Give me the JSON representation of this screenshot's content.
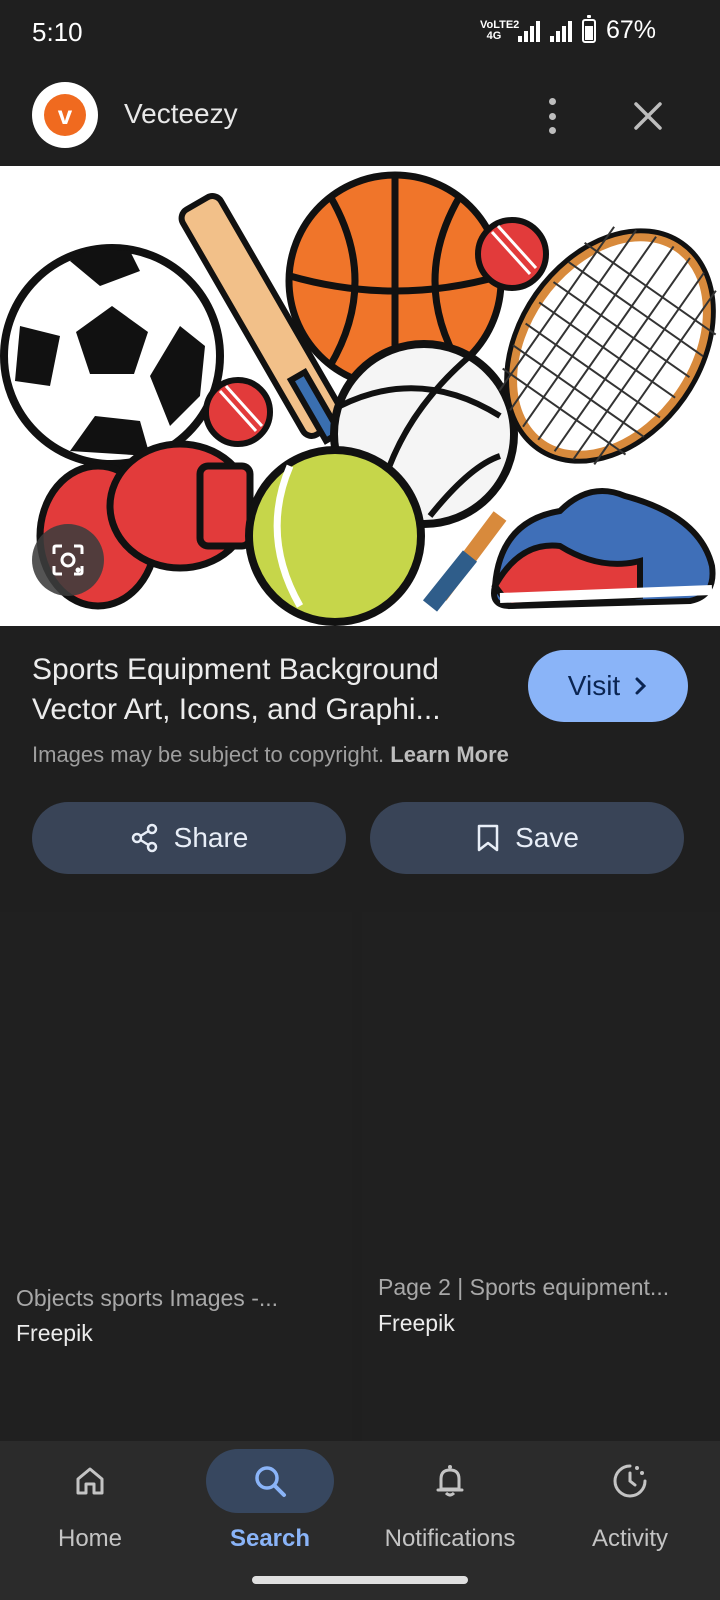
{
  "status_bar": {
    "time": "5:10",
    "network": "VoLTE2 4G",
    "battery_percent": "67%",
    "battery_level": 0.67
  },
  "app_bar": {
    "site_name": "Vecteezy",
    "site_logo_letter": "v",
    "menu_icon": "more-vert-icon",
    "close_icon": "close-icon"
  },
  "result": {
    "title_line1": "Sports Equipment Background",
    "title_line2": "Vector Art, Icons, and Graphi...",
    "visit_label": "Visit",
    "copyright_text": "Images may be subject to copyright.",
    "learn_more": "Learn More",
    "share_label": "Share",
    "save_label": "Save"
  },
  "related": [
    {
      "title": "Objects sports Images -...",
      "source": "Freepik"
    },
    {
      "title": "Page 2 | Sports equipment...",
      "source": "Freepik"
    }
  ],
  "bottom_nav": {
    "items": [
      {
        "label": "Home",
        "icon": "home-icon",
        "active": false
      },
      {
        "label": "Search",
        "icon": "search-icon",
        "active": true
      },
      {
        "label": "Notifications",
        "icon": "bell-icon",
        "active": false
      },
      {
        "label": "Activity",
        "icon": "activity-icon",
        "active": false
      }
    ]
  },
  "colors": {
    "background": "#1f1f1f",
    "accent": "#8ab4f8",
    "button_bg": "#394457",
    "brand": "#f06a1f"
  }
}
